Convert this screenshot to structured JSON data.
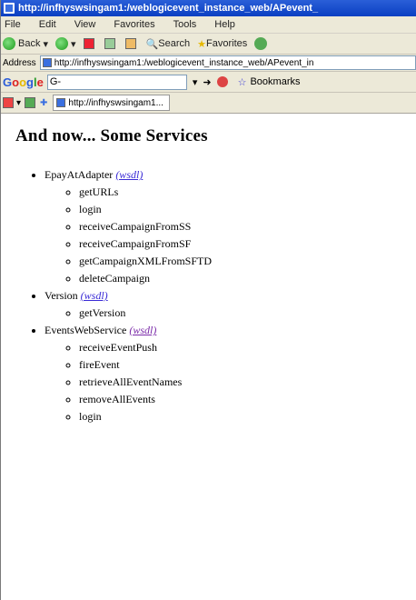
{
  "window": {
    "title": "http://infhyswsingam1:/weblogicevent_instance_web/APevent_"
  },
  "menu": [
    "File",
    "Edit",
    "View",
    "Favorites",
    "Tools",
    "Help"
  ],
  "toolbar": {
    "back": "Back",
    "search": "Search",
    "favorites": "Favorites"
  },
  "address": {
    "label": "Address",
    "url": "http://infhyswsingam1:/weblogicevent_instance_web/APevent_in"
  },
  "google": {
    "logo": "Google",
    "search_value": "G-",
    "extra": "Bookmarks"
  },
  "tab": {
    "label": "http://infhyswsingam1..."
  },
  "page": {
    "heading": "And now... Some Services",
    "services": [
      {
        "name": "EpayAtAdapter",
        "link": "(wsdl)",
        "ops": [
          "getURLs",
          "login",
          "receiveCampaignFromSS",
          "receiveCampaignFromSF",
          "getCampaignXMLFromSFTD",
          "deleteCampaign"
        ]
      },
      {
        "name": "Version",
        "link": "(wsdl)",
        "ops": [
          "getVersion"
        ]
      },
      {
        "name": "EventsWebService",
        "link": "(wsdl)",
        "ops": [
          "receiveEventPush",
          "fireEvent",
          "retrieveAllEventNames",
          "removeAllEvents",
          "login"
        ]
      }
    ]
  }
}
